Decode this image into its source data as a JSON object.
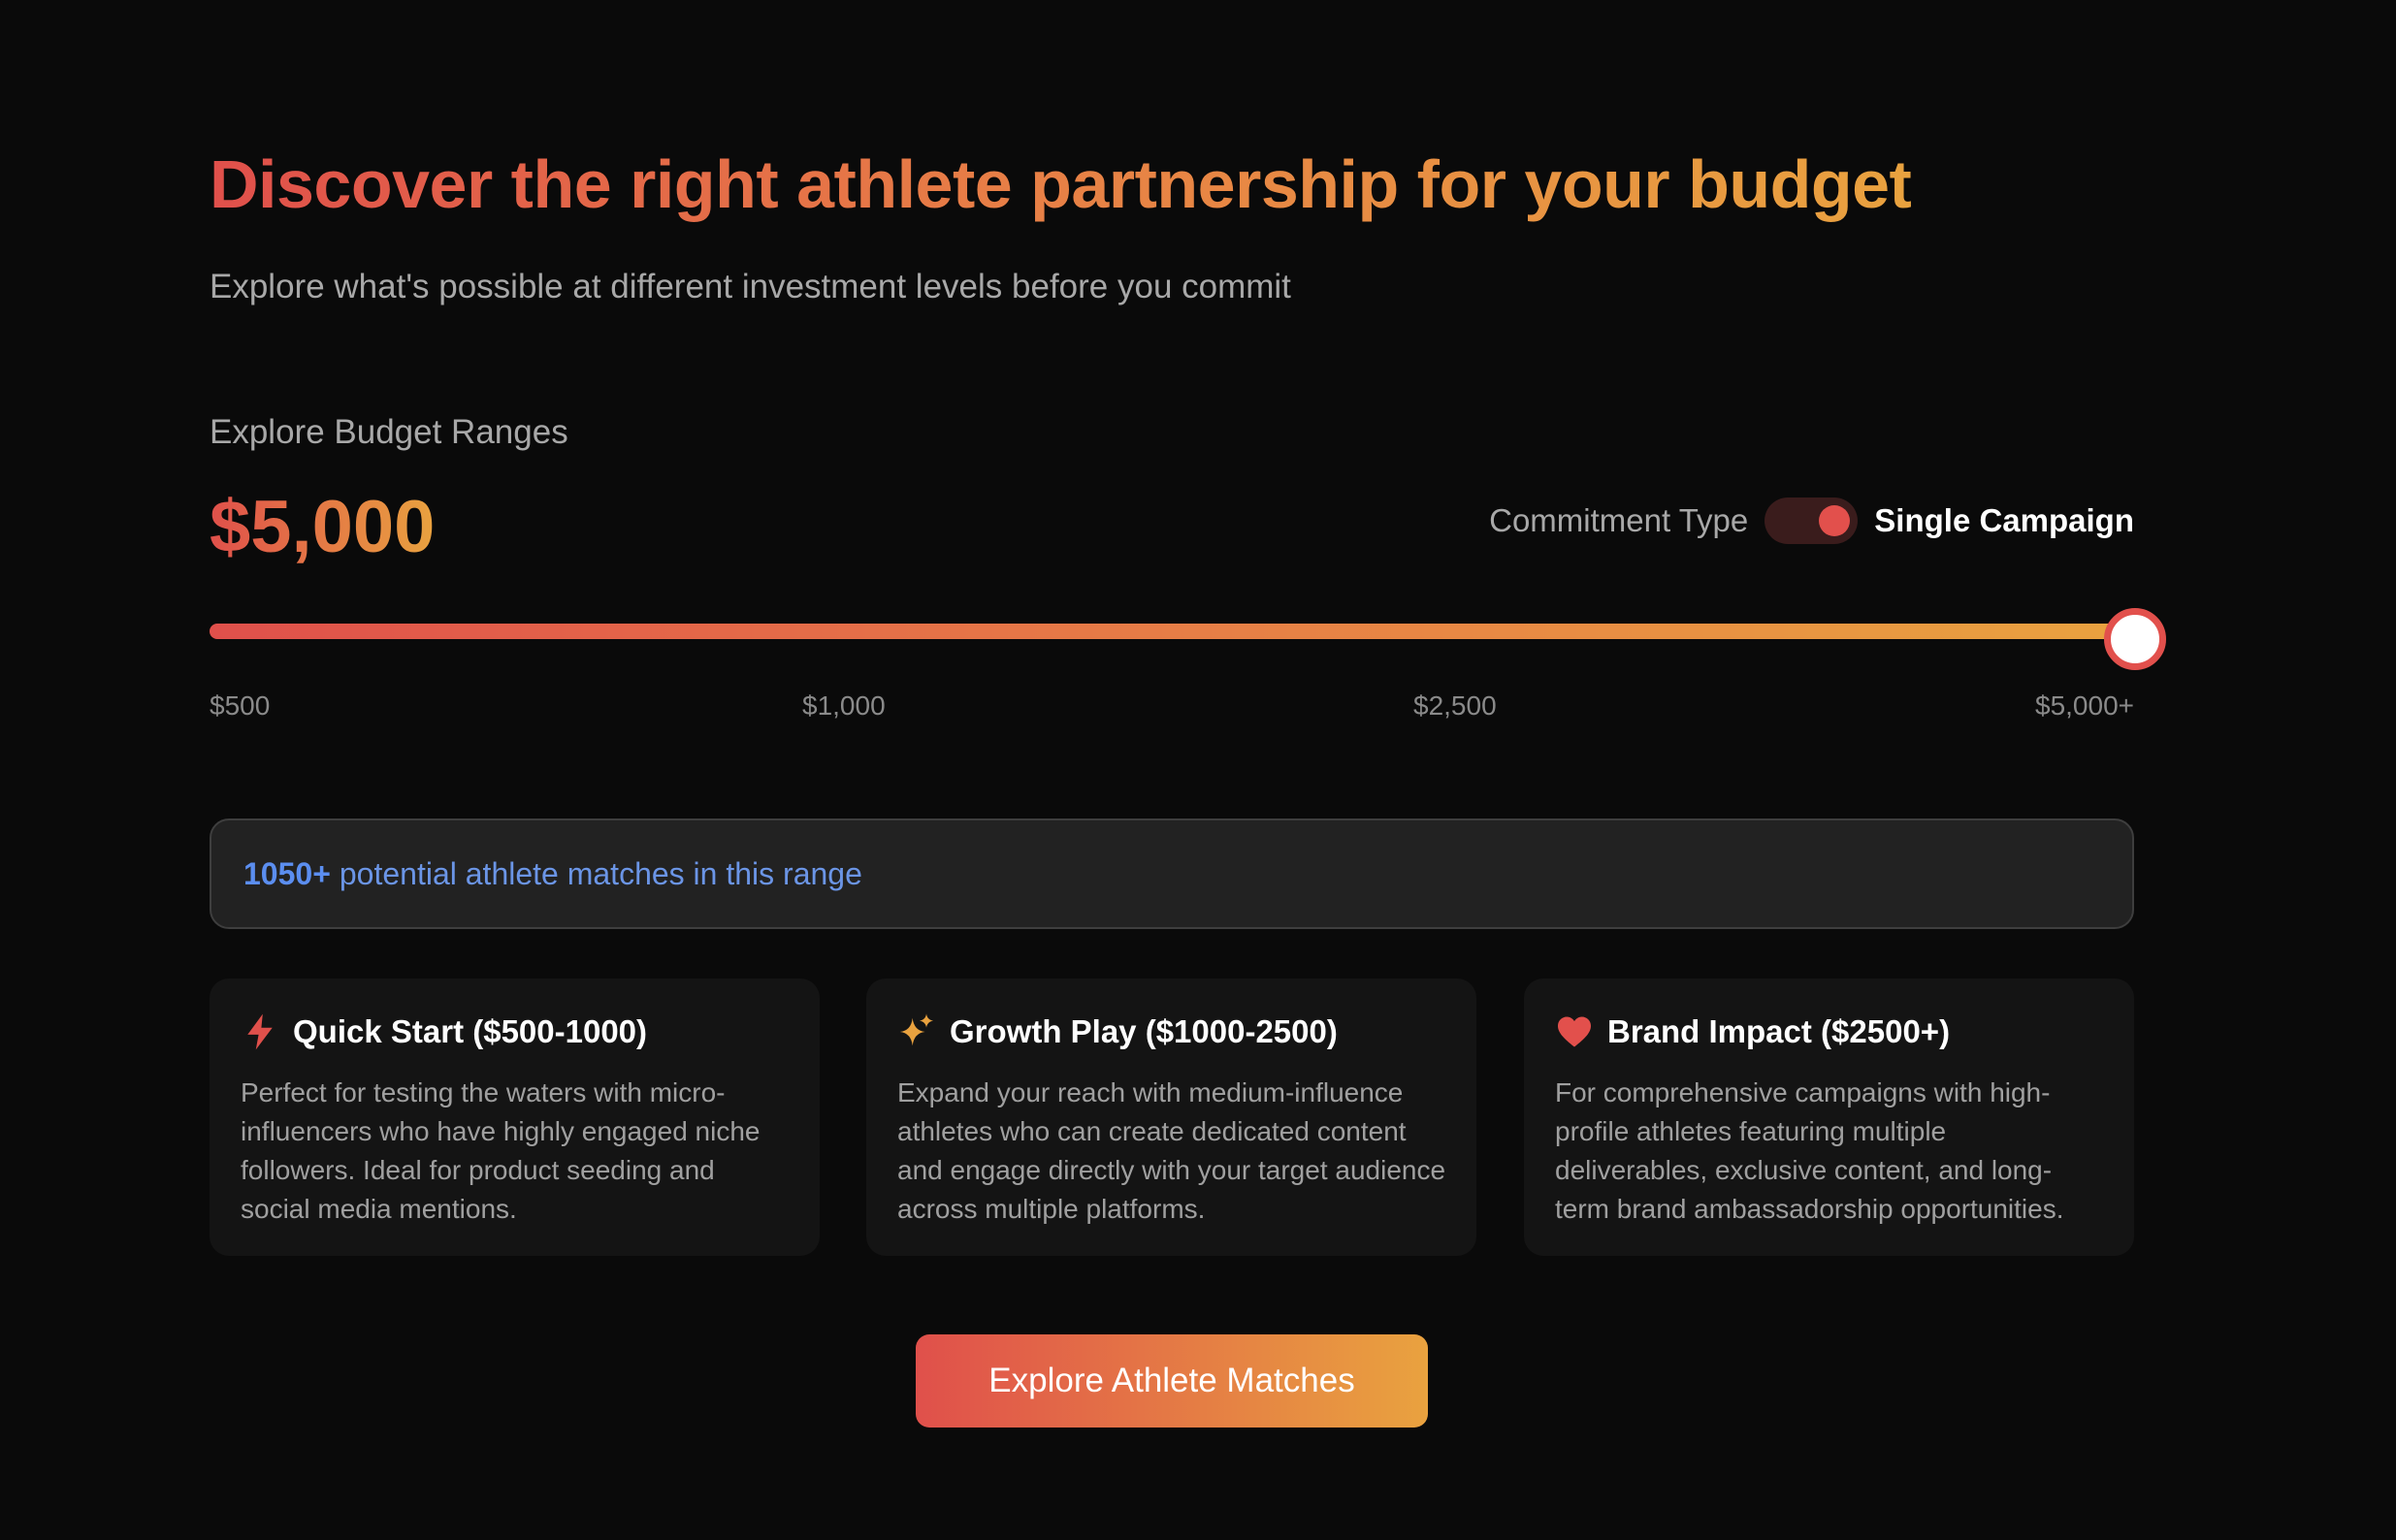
{
  "header": {
    "title": "Discover the right athlete partnership for your budget",
    "subtitle": "Explore what's possible at different investment levels before you commit"
  },
  "budget": {
    "section_label": "Explore Budget Ranges",
    "amount": "$5,000",
    "slider_level": 1.0,
    "ticks": [
      "$500",
      "$1,000",
      "$2,500",
      "$5,000+"
    ]
  },
  "commitment": {
    "label": "Commitment Type",
    "value": "Single Campaign",
    "toggle_on": true
  },
  "matches": {
    "count": "1050+",
    "text": "potential athlete matches in this range"
  },
  "cards": [
    {
      "icon": "lightning-icon",
      "title": "Quick Start ($500-1000)",
      "description": "Perfect for testing the waters with micro-influencers who have highly engaged niche followers. Ideal for product seeding and social media mentions."
    },
    {
      "icon": "sparkles-icon",
      "title": "Growth Play ($1000-2500)",
      "description": "Expand your reach with medium-influence athletes who can create dedicated content and engage directly with your target audience across multiple platforms."
    },
    {
      "icon": "heart-icon",
      "title": "Brand Impact ($2500+)",
      "description": "For comprehensive campaigns with high-profile athletes featuring multiple deliverables, exclusive content, and long-term brand ambassadorship opportunities."
    }
  ],
  "cta": {
    "label": "Explore Athlete Matches"
  },
  "colors": {
    "background": "#0a0a0a",
    "accent_red": "#e0504b",
    "accent_orange": "#e9a23f",
    "matches_blue": "#5b8ef0"
  }
}
